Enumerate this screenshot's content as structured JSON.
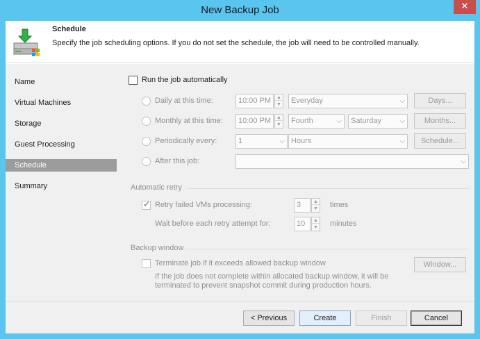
{
  "window": {
    "title": "New Backup Job",
    "close_glyph": "✕"
  },
  "header": {
    "title": "Schedule",
    "description": "Specify the job scheduling options. If you do not set the schedule, the job will need to be controlled manually.",
    "icon": "backup-job-icon"
  },
  "sidebar": {
    "items": [
      {
        "label": "Name",
        "active": false
      },
      {
        "label": "Virtual Machines",
        "active": false
      },
      {
        "label": "Storage",
        "active": false
      },
      {
        "label": "Guest Processing",
        "active": false
      },
      {
        "label": "Schedule",
        "active": true
      },
      {
        "label": "Summary",
        "active": false
      }
    ]
  },
  "schedule": {
    "run_auto": {
      "label": "Run the job automatically",
      "checked": false
    },
    "daily": {
      "label": "Daily at this time:",
      "time": "10:00 PM",
      "days_value": "Everyday",
      "button": "Days..."
    },
    "monthly": {
      "label": "Monthly at this time:",
      "time": "10:00 PM",
      "week": "Fourth",
      "day": "Saturday",
      "button": "Months..."
    },
    "periodic": {
      "label": "Periodically every:",
      "value": "1",
      "unit": "Hours",
      "button": "Schedule..."
    },
    "after": {
      "label": "After this job:",
      "value": ""
    }
  },
  "retry": {
    "section": "Automatic retry",
    "retry_failed": {
      "label": "Retry failed VMs processing:",
      "checked": true,
      "value": "3",
      "unit": "times"
    },
    "wait": {
      "label": "Wait before each retry attempt for:",
      "value": "10",
      "unit": "minutes"
    }
  },
  "backup_window": {
    "section": "Backup window",
    "terminate": {
      "label": "Terminate job if it exceeds allowed backup window",
      "checked": false
    },
    "button": "Window...",
    "note_line1": "If the job does not complete within allocated backup window, it will be",
    "note_line2": "terminated to prevent snapshot commit during production hours."
  },
  "footer": {
    "previous": "< Previous",
    "create": "Create",
    "finish": "Finish",
    "cancel": "Cancel"
  },
  "colors": {
    "titlebar": "#5ac5ef",
    "close": "#c7504f",
    "active_nav": "#9c9c9c"
  }
}
